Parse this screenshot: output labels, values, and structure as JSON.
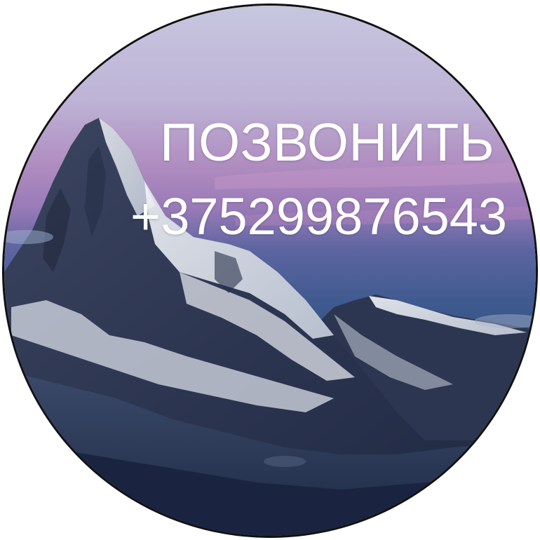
{
  "call_button": {
    "title": "ПОЗВОНИТЬ",
    "phone": "+375299876543"
  },
  "colors": {
    "text": "#ffffff",
    "outline": "#111111",
    "sky_top": "#c9c6e0",
    "sky_pink": "#b590c0",
    "sky_bottom": "#3e5a92",
    "mountain_dark": "#2a3550",
    "snow": "#e8ecf2"
  },
  "background": {
    "icon": "mountain-landscape"
  }
}
